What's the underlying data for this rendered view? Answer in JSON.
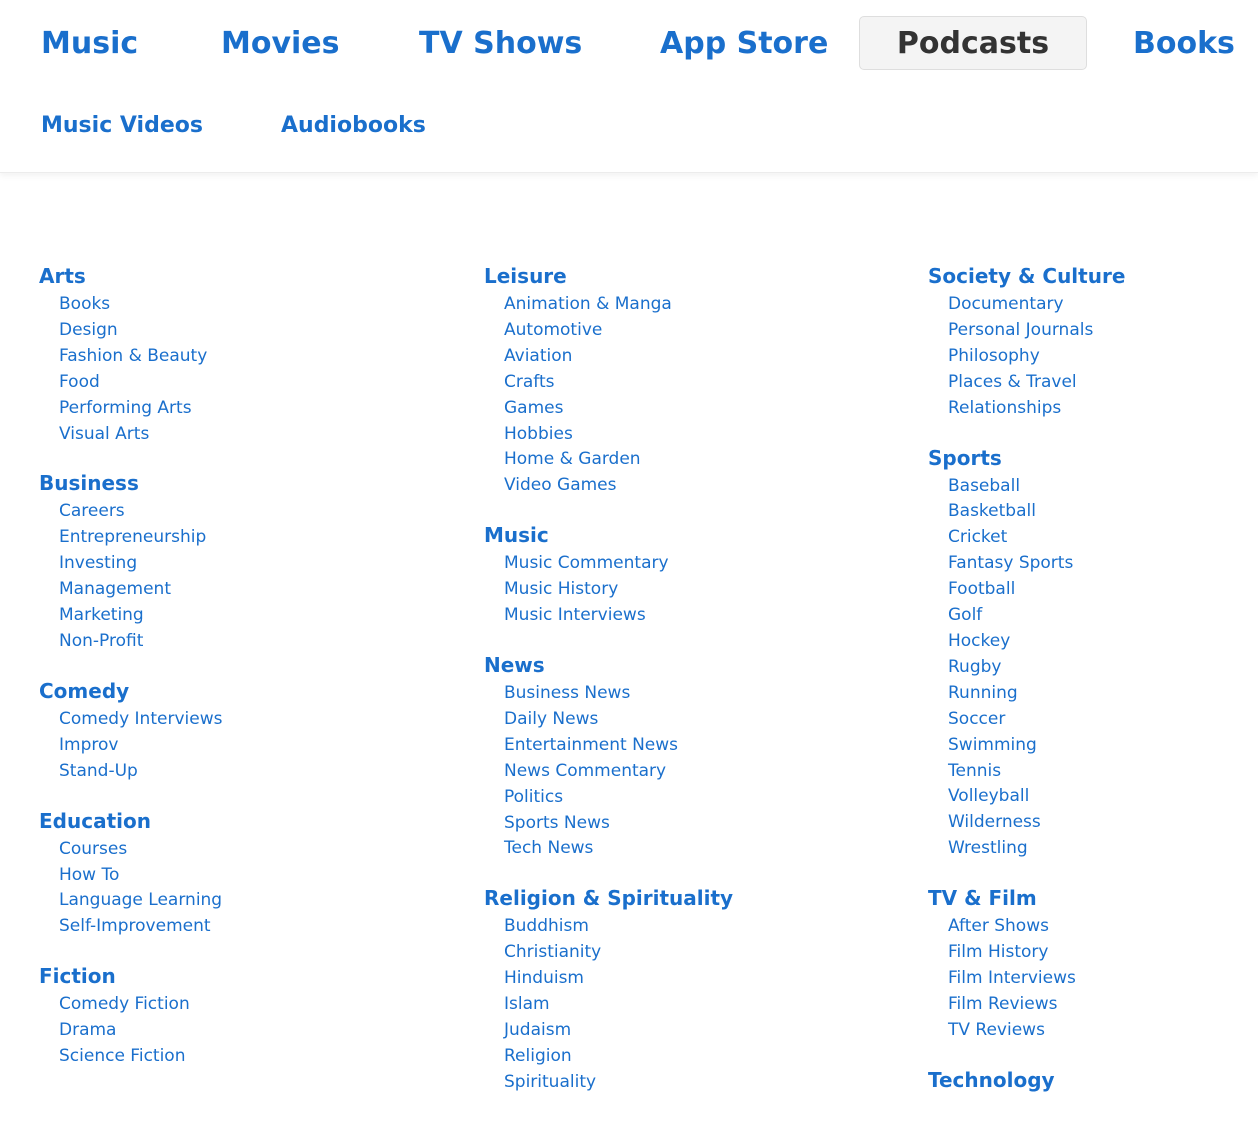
{
  "nav": {
    "primary": [
      {
        "label": "Music",
        "active": false
      },
      {
        "label": "Movies",
        "active": false
      },
      {
        "label": "TV Shows",
        "active": false
      },
      {
        "label": "App Store",
        "active": false
      },
      {
        "label": "Podcasts",
        "active": true
      },
      {
        "label": "Books",
        "active": false
      }
    ],
    "secondary": [
      "Music Videos",
      "Audiobooks"
    ]
  },
  "colors": {
    "link": "#1a6fcc",
    "active_tab_bg": "#f4f4f4",
    "active_tab_text": "#333333"
  },
  "columns": [
    [
      {
        "title": "Arts",
        "items": [
          "Books",
          "Design",
          "Fashion & Beauty",
          "Food",
          "Performing Arts",
          "Visual Arts"
        ]
      },
      {
        "title": "Business",
        "items": [
          "Careers",
          "Entrepreneurship",
          "Investing",
          "Management",
          "Marketing",
          "Non-Profit"
        ]
      },
      {
        "title": "Comedy",
        "items": [
          "Comedy Interviews",
          "Improv",
          "Stand-Up"
        ]
      },
      {
        "title": "Education",
        "items": [
          "Courses",
          "How To",
          "Language Learning",
          "Self-Improvement"
        ]
      },
      {
        "title": "Fiction",
        "items": [
          "Comedy Fiction",
          "Drama",
          "Science Fiction"
        ]
      }
    ],
    [
      {
        "title": "Leisure",
        "items": [
          "Animation & Manga",
          "Automotive",
          "Aviation",
          "Crafts",
          "Games",
          "Hobbies",
          "Home & Garden",
          "Video Games"
        ]
      },
      {
        "title": "Music",
        "items": [
          "Music Commentary",
          "Music History",
          "Music Interviews"
        ]
      },
      {
        "title": "News",
        "items": [
          "Business News",
          "Daily News",
          "Entertainment News",
          "News Commentary",
          "Politics",
          "Sports News",
          "Tech News"
        ]
      },
      {
        "title": "Religion & Spirituality",
        "items": [
          "Buddhism",
          "Christianity",
          "Hinduism",
          "Islam",
          "Judaism",
          "Religion",
          "Spirituality"
        ]
      }
    ],
    [
      {
        "title": "Society & Culture",
        "items": [
          "Documentary",
          "Personal Journals",
          "Philosophy",
          "Places & Travel",
          "Relationships"
        ]
      },
      {
        "title": "Sports",
        "items": [
          "Baseball",
          "Basketball",
          "Cricket",
          "Fantasy Sports",
          "Football",
          "Golf",
          "Hockey",
          "Rugby",
          "Running",
          "Soccer",
          "Swimming",
          "Tennis",
          "Volleyball",
          "Wilderness",
          "Wrestling"
        ]
      },
      {
        "title": "TV & Film",
        "items": [
          "After Shows",
          "Film History",
          "Film Interviews",
          "Film Reviews",
          "TV Reviews"
        ]
      },
      {
        "title": "Technology",
        "items": []
      }
    ]
  ]
}
